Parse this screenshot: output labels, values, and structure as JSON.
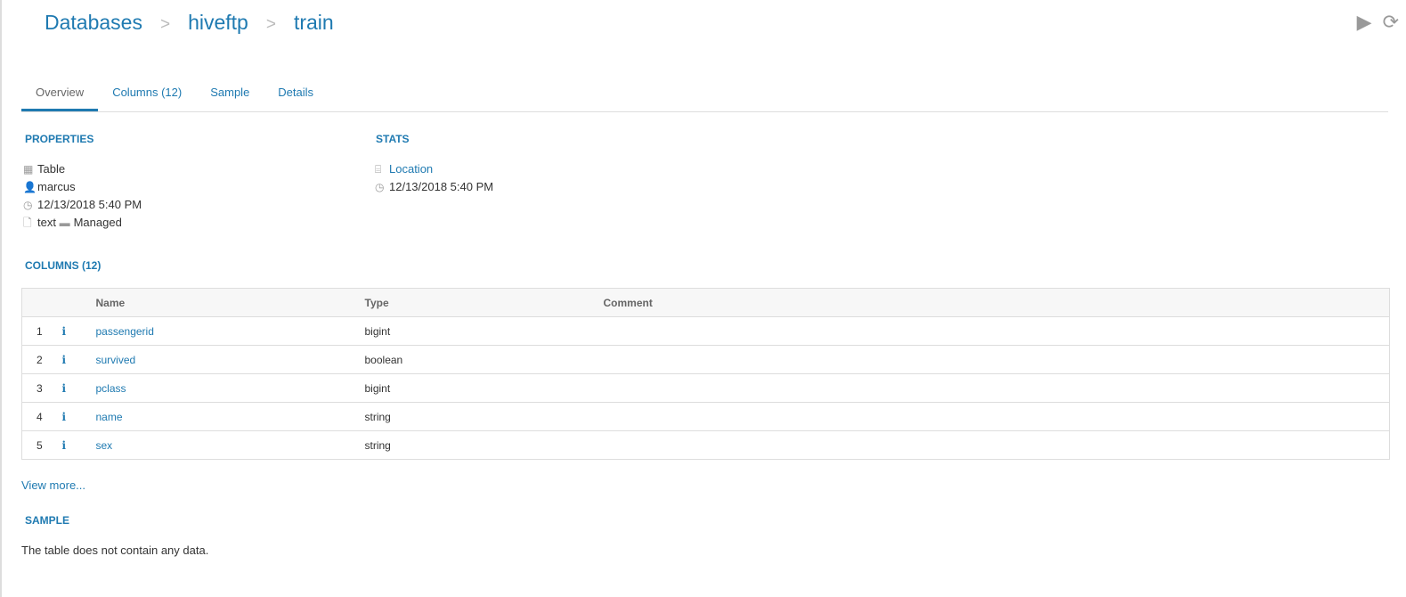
{
  "breadcrumb": [
    "Databases",
    "hiveftp",
    "train"
  ],
  "actions": {
    "run_icon": "play-icon",
    "refresh_icon": "refresh-icon"
  },
  "tabs": [
    {
      "label": "Overview",
      "active": true
    },
    {
      "label": "Columns (12)"
    },
    {
      "label": "Sample"
    },
    {
      "label": "Details"
    }
  ],
  "properties": {
    "title": "PROPERTIES",
    "type": "Table",
    "owner": "marcus",
    "created": "12/13/2018 5:40 PM",
    "format": "text",
    "managed": "Managed"
  },
  "stats": {
    "title": "STATS",
    "location": "Location",
    "updated": "12/13/2018 5:40 PM"
  },
  "columns": {
    "title": "COLUMNS (12)",
    "headers": [
      "Name",
      "Type",
      "Comment"
    ],
    "rows": [
      {
        "n": "1",
        "name": "passengerid",
        "type": "bigint",
        "comment": ""
      },
      {
        "n": "2",
        "name": "survived",
        "type": "boolean",
        "comment": ""
      },
      {
        "n": "3",
        "name": "pclass",
        "type": "bigint",
        "comment": ""
      },
      {
        "n": "4",
        "name": "name",
        "type": "string",
        "comment": ""
      },
      {
        "n": "5",
        "name": "sex",
        "type": "string",
        "comment": ""
      }
    ],
    "view_more": "View more..."
  },
  "sample": {
    "title": "SAMPLE",
    "empty": "The table does not contain any data."
  }
}
